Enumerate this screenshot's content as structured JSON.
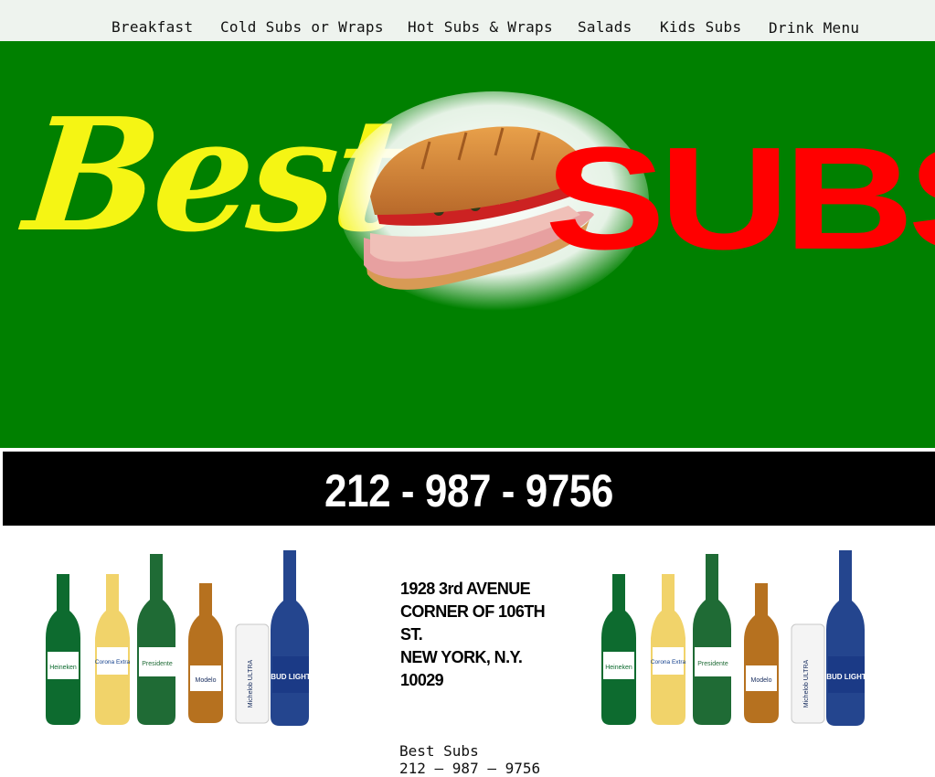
{
  "nav": {
    "items": [
      {
        "label": "Breakfast"
      },
      {
        "label": "Cold Subs or Wraps"
      },
      {
        "label": "Hot Subs & Wraps"
      },
      {
        "label": "Salads"
      },
      {
        "label": "Kids Subs"
      },
      {
        "label": "Drink Menu"
      }
    ]
  },
  "hero": {
    "logo_word_1": "Best",
    "logo_word_2": "SUBS",
    "bg_color": "#008000",
    "word_1_color": "#f5f514",
    "word_2_color": "#ff0000"
  },
  "phone_banner": {
    "phone": "212 - 987 - 9756"
  },
  "address": {
    "line1": "1928 3rd AVENUE",
    "line2": "CORNER OF 106TH ST.",
    "line3": "NEW YORK, N.Y. 10029"
  },
  "footer": {
    "name": "Best Subs",
    "phone": "212 – 987 – 9756"
  },
  "images": {
    "beers_labels": [
      "Heineken",
      "Corona Extra",
      "Presidente",
      "Modelo",
      "Michelob ULTRA",
      "BUD LIGHT"
    ]
  }
}
